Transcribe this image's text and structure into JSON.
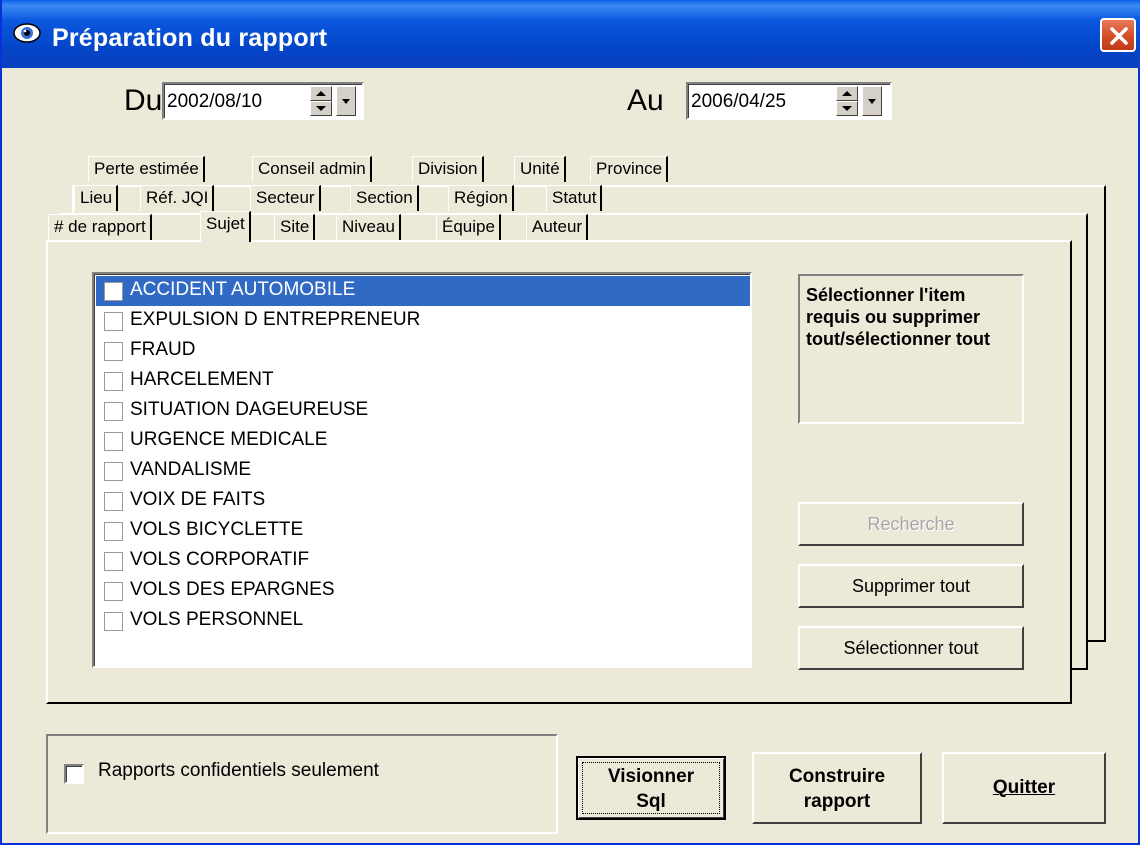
{
  "window": {
    "title": "Préparation du rapport",
    "accent": "#0A5FE8",
    "close_color": "#D14A22"
  },
  "dates": {
    "from_label": "Du",
    "from_value": "2002/08/10",
    "to_label": "Au",
    "to_value": "2006/04/25"
  },
  "tabs": {
    "row3": [
      "Perte estimée",
      "Conseil admin",
      "Division",
      "Unité",
      "Province"
    ],
    "row2": [
      "Lieu",
      "Réf. JQI",
      "Secteur",
      "Section",
      "Région",
      "Statut"
    ],
    "row1": [
      "# de rapport",
      "Sujet",
      "Site",
      "Niveau",
      "Équipe",
      "Auteur"
    ],
    "active": "Sujet"
  },
  "list": {
    "items": [
      {
        "label": "ACCIDENT AUTOMOBILE",
        "checked": false,
        "selected": true
      },
      {
        "label": "EXPULSION D ENTREPRENEUR",
        "checked": false,
        "selected": false
      },
      {
        "label": "FRAUD",
        "checked": false,
        "selected": false
      },
      {
        "label": "HARCELEMENT",
        "checked": false,
        "selected": false
      },
      {
        "label": "SITUATION DAGEUREUSE",
        "checked": false,
        "selected": false
      },
      {
        "label": "URGENCE MEDICALE",
        "checked": false,
        "selected": false
      },
      {
        "label": "VANDALISME",
        "checked": false,
        "selected": false
      },
      {
        "label": "VOIX DE FAITS",
        "checked": false,
        "selected": false
      },
      {
        "label": "VOLS BICYCLETTE",
        "checked": false,
        "selected": false
      },
      {
        "label": "VOLS CORPORATIF",
        "checked": false,
        "selected": false
      },
      {
        "label": "VOLS DES EPARGNES",
        "checked": false,
        "selected": false
      },
      {
        "label": "VOLS PERSONNEL",
        "checked": false,
        "selected": false
      }
    ],
    "selection_color": "#316AC5"
  },
  "info": {
    "text": "Sélectionner l'item requis ou supprimer tout/sélectionner tout"
  },
  "buttons": {
    "search": "Recherche",
    "clear_all": "Supprimer tout",
    "select_all": "Sélectionner tout",
    "view_sql_line1": "Visionner",
    "view_sql_line2": "Sql",
    "build_line1": "Construire",
    "build_line2": "rapport",
    "quit": "Quitter"
  },
  "options": {
    "confidential_label": "Rapports confidentiels seulement",
    "confidential_checked": false
  }
}
